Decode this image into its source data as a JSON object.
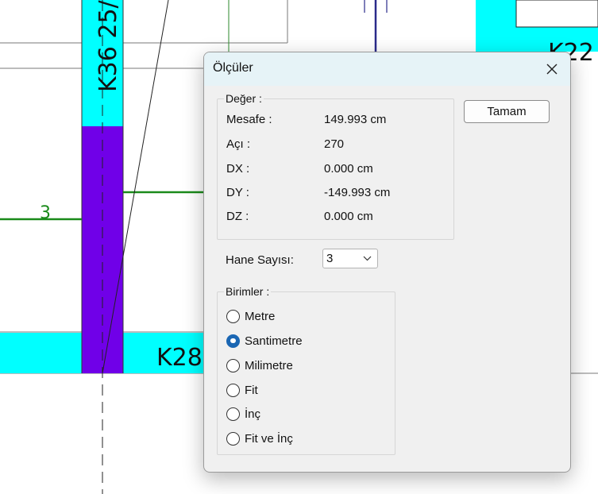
{
  "cad": {
    "labels": {
      "k36": "K36 25/",
      "k28": "K28",
      "k22": "K22",
      "dim": "3"
    },
    "colors": {
      "beam": "#00ffff",
      "column": "#7000e8",
      "green_line": "#1a8a1a",
      "navy_line": "#2a2a8a"
    }
  },
  "dialog": {
    "title": "Ölçüler",
    "close_icon": "close-icon",
    "deger": {
      "legend": "Değer :",
      "rows": [
        {
          "label": "Mesafe :",
          "value": "149.993 cm"
        },
        {
          "label": "Açı :",
          "value": "270"
        },
        {
          "label": "DX :",
          "value": "0.000 cm"
        },
        {
          "label": "DY :",
          "value": "-149.993 cm"
        },
        {
          "label": "DZ :",
          "value": "0.000 cm"
        }
      ]
    },
    "ok_button": "Tamam",
    "hane": {
      "label": "Hane Sayısı:",
      "value": "3"
    },
    "birimler": {
      "legend": "Birimler :",
      "options": [
        {
          "label": "Metre",
          "checked": false
        },
        {
          "label": "Santimetre",
          "checked": true
        },
        {
          "label": "Milimetre",
          "checked": false
        },
        {
          "label": "Fit",
          "checked": false
        },
        {
          "label": "İnç",
          "checked": false
        },
        {
          "label": "Fit ve İnç",
          "checked": false
        }
      ]
    }
  }
}
